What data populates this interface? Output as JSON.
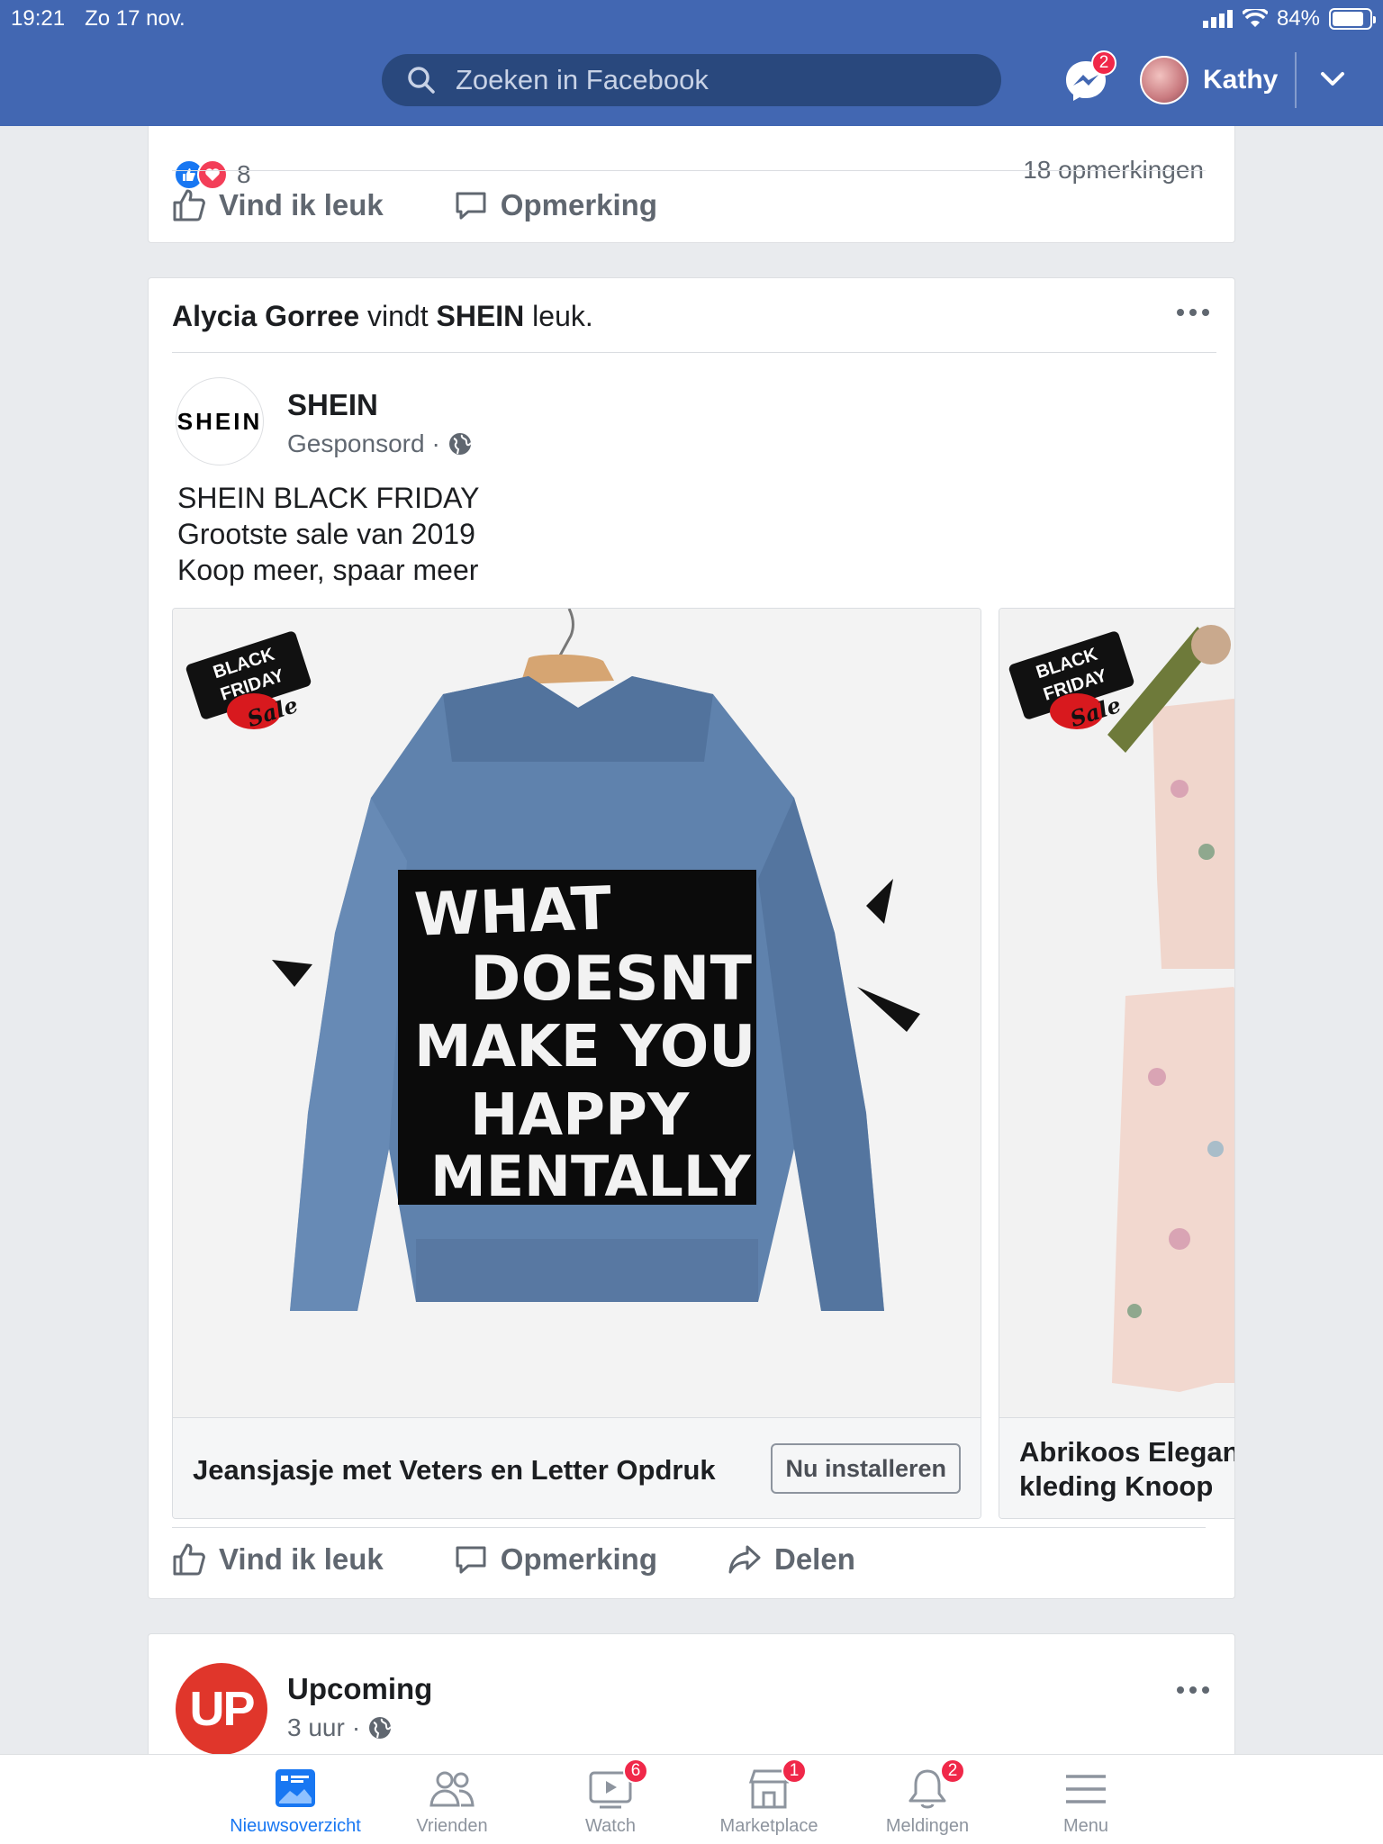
{
  "status_bar": {
    "time": "19:21",
    "date": "Zo 17 nov.",
    "battery": "84%",
    "battery_level": 0.84
  },
  "header": {
    "search_placeholder": "Zoeken in Facebook",
    "messenger_badge": "2",
    "username": "Kathy"
  },
  "prev_post": {
    "reaction_count": "8",
    "comments": "18 opmerkingen",
    "like_label": "Vind ik leuk",
    "comment_label": "Opmerking"
  },
  "ad_post": {
    "friend": "Alycia Gorree",
    "liked_verb": "vindt",
    "liked_page": "SHEIN",
    "liked_suffix": "leuk.",
    "page_name": "SHEIN",
    "logo_text": "SHEIN",
    "sponsored": "Gesponsord",
    "text_lines": [
      "SHEIN BLACK FRIDAY",
      "Grootste sale van 2019",
      "Koop meer, spaar meer"
    ],
    "badge_lines": [
      "BLACK",
      "FRIDAY",
      "Sale"
    ],
    "carousel": [
      {
        "title": "Jeansjasje met Veters en Letter Opdruk",
        "button": "Nu installeren",
        "jacket_print": [
          "WHAT",
          "DOESNT",
          "MAKE YOU",
          "HAPPY",
          "MENTALLY"
        ]
      },
      {
        "title_line1": "Abrikoos Elegan",
        "title_line2": "kleding Knoop"
      }
    ],
    "like_label": "Vind ik leuk",
    "comment_label": "Opmerking",
    "share_label": "Delen"
  },
  "next_post": {
    "page_name": "Upcoming",
    "logo_text": "UP",
    "time": "3 uur"
  },
  "tabbar": [
    {
      "label": "Nieuwsoverzicht",
      "icon": "news-feed-icon",
      "badge": ""
    },
    {
      "label": "Vrienden",
      "icon": "friends-icon",
      "badge": ""
    },
    {
      "label": "Watch",
      "icon": "watch-icon",
      "badge": "6"
    },
    {
      "label": "Marketplace",
      "icon": "marketplace-icon",
      "badge": "1"
    },
    {
      "label": "Meldingen",
      "icon": "bell-icon",
      "badge": "2"
    },
    {
      "label": "Menu",
      "icon": "menu-icon",
      "badge": ""
    }
  ],
  "colors": {
    "brand": "#4267b2",
    "accent": "#1877f2",
    "badge": "#f02849"
  }
}
